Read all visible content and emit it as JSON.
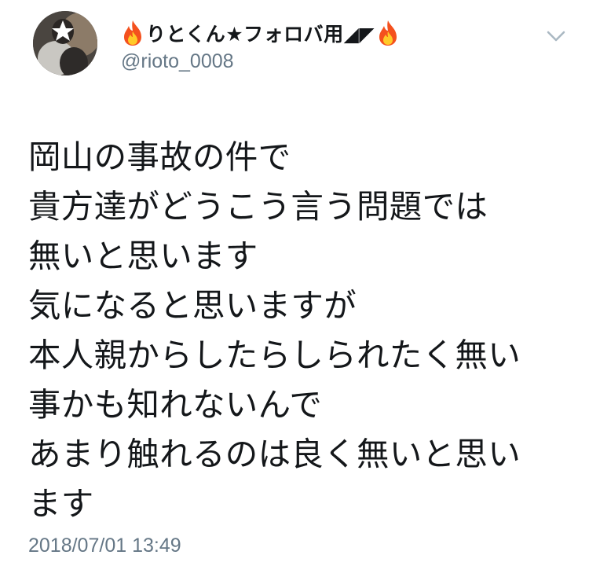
{
  "tweet": {
    "avatar_icon": "profile-photo-icon",
    "display_name": {
      "prefix_icon": "fire-emoji-icon",
      "text": "りとくん★フォロバ用◢◤",
      "suffix_icon": "fire-emoji-icon"
    },
    "handle": "@rioto_0008",
    "menu_icon": "chevron-down-icon",
    "body_lines": [
      "岡山の事故の件で",
      "貴方達がどうこう言う問題では",
      "無いと思います",
      "気になると思いますが",
      "本人親からしたらしられたく無い",
      "事かも知れないんで",
      "あまり触れるのは良く無いと思い",
      "ます"
    ],
    "timestamp": "2018/07/01 13:49"
  },
  "colors": {
    "text": "#14171a",
    "secondary": "#657786",
    "chevron": "#aab8c2",
    "fire_outer": "#f4511e",
    "fire_inner": "#ffca28"
  }
}
